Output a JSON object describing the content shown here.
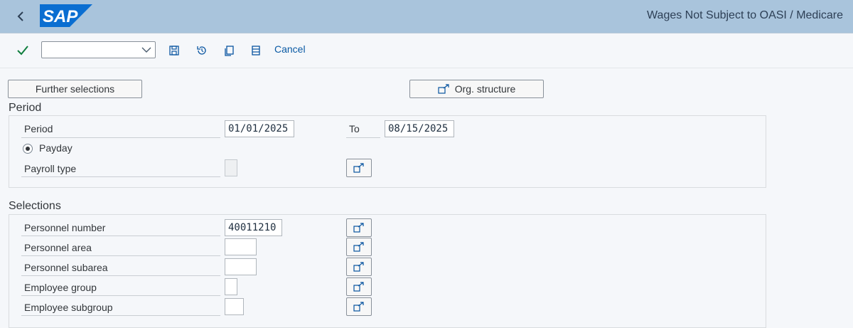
{
  "header": {
    "logo_text": "SAP",
    "title": "Wages Not Subject to OASI / Medicare",
    "back_icon": "back-icon"
  },
  "toolbar": {
    "variant_value": "",
    "icons": [
      "checkmark-icon",
      "save-icon",
      "history-icon",
      "copy-icon",
      "list-icon"
    ],
    "cancel_label": "Cancel"
  },
  "buttons": {
    "further_selections": "Further selections",
    "org_structure": "Org. structure"
  },
  "period": {
    "section_title": "Period",
    "period_label": "Period",
    "period_from": "01/01/2025",
    "to_label": "To",
    "period_to": "08/15/2025",
    "payday_label": "Payday",
    "payroll_type_label": "Payroll type",
    "payroll_type_value": ""
  },
  "selections": {
    "section_title": "Selections",
    "rows": [
      {
        "label": "Personnel number",
        "value": "40011210"
      },
      {
        "label": "Personnel area",
        "value": ""
      },
      {
        "label": "Personnel subarea",
        "value": ""
      },
      {
        "label": "Employee group",
        "value": ""
      },
      {
        "label": "Employee subgroup",
        "value": ""
      }
    ]
  },
  "colors": {
    "shell_bar": "#a9c4dc",
    "logo_blue": "#0a6ed1",
    "accept_green": "#107e3e",
    "link_blue": "#0a5aa4"
  }
}
